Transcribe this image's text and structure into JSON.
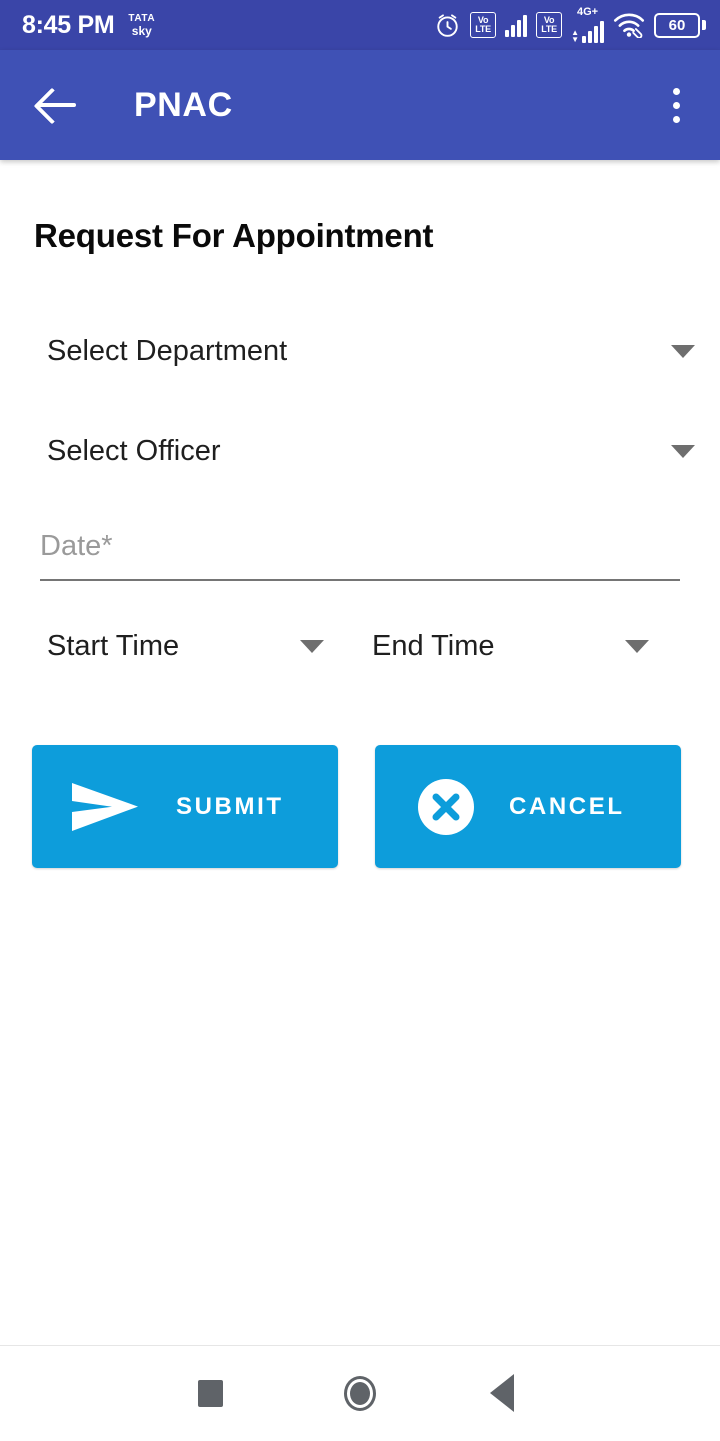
{
  "status_bar": {
    "time": "8:45 PM",
    "carrier_logo_line1": "TATA",
    "carrier_logo_line2": "sky",
    "alarm_icon": "alarm-clock-icon",
    "sim1_volte_line1": "Vo",
    "sim1_volte_line2": "LTE",
    "sim2_volte_line1": "Vo",
    "sim2_volte_line2": "LTE",
    "network_type": "4G+",
    "wifi_icon": "wifi-icon",
    "battery_percent": "60",
    "background_color": "#3a45a8"
  },
  "app_bar": {
    "back_label": "back-arrow",
    "title": "PNAC",
    "overflow_label": "more-options",
    "background_color": "#3f51b5"
  },
  "main": {
    "page_title": "Request For Appointment",
    "fields": {
      "department": {
        "label": "Select Department",
        "type": "spinner"
      },
      "officer": {
        "label": "Select Officer",
        "type": "spinner"
      },
      "date": {
        "placeholder": "Date*",
        "value": "",
        "type": "text"
      },
      "start_time": {
        "label": "Start Time",
        "type": "spinner"
      },
      "end_time": {
        "label": "End Time",
        "type": "spinner"
      }
    },
    "buttons": {
      "submit": {
        "label": "SUBMIT",
        "icon": "send-icon",
        "color": "#0d9ddb"
      },
      "cancel": {
        "label": "CANCEL",
        "icon": "cancel-circle-icon",
        "color": "#0d9ddb"
      }
    }
  },
  "nav_bar": {
    "recents": "recents-square",
    "home": "home-circle",
    "back": "back-triangle"
  }
}
